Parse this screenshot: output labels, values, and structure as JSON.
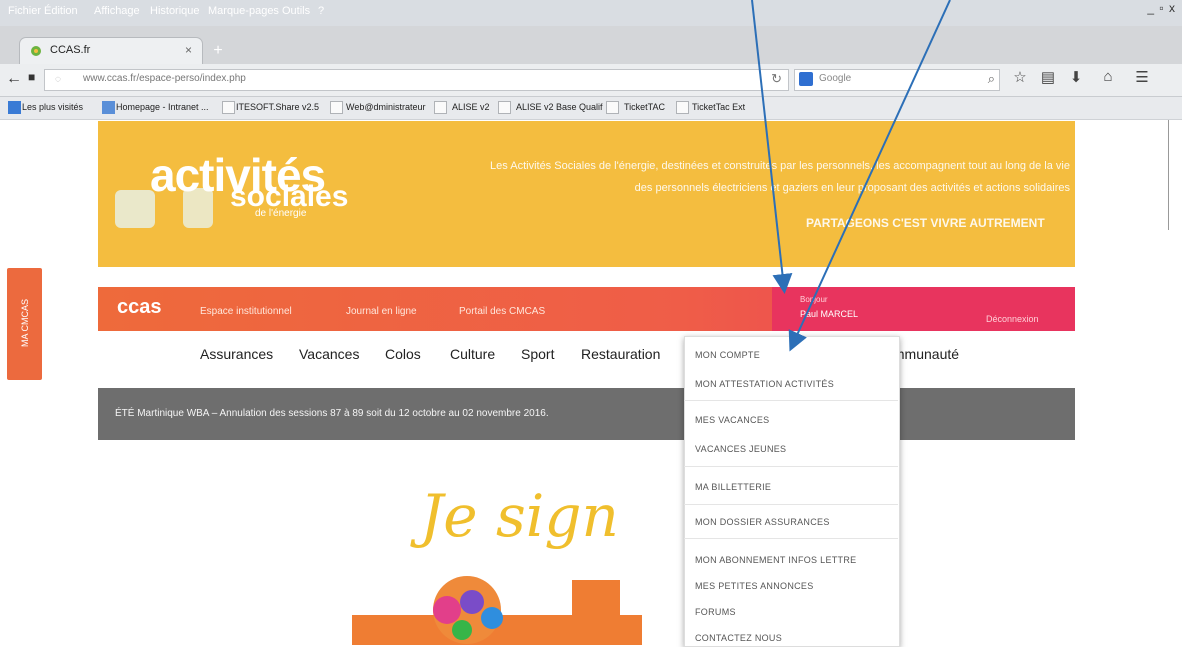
{
  "menubar": {
    "items": [
      "Fichier",
      "Édition",
      "Affichage",
      "Historique",
      "Marque-pages",
      "Outils",
      "?"
    ],
    "controls": "_ ▫ x"
  },
  "tab": {
    "title": "CCAS.fr",
    "close": "×",
    "new": "+"
  },
  "navbar": {
    "url": "www.ccas.fr/espace-perso/index.php",
    "search_placeholder": "Google"
  },
  "bookmarks": [
    "Les plus visités",
    "Homepage - Intranet ...",
    "ITESOFT.Share v2.5",
    "Web@dministrateur",
    "ALISE v2",
    "ALISE v2 Base Qualif",
    "TicketTAC",
    "TicketTac Ext"
  ],
  "header": {
    "logo_line1": "activités",
    "logo_line2": "sociales",
    "logo_sub": "de l'énergie",
    "text_line1": "Les Activités Sociales de l'énergie, destinées et construites par les personnels, les accompagnent tout au long de la vie",
    "text_line2": "des personnels électriciens et gaziers en leur proposant des activités et actions solidaires",
    "slogan": "PARTAGEONS C'EST VIVRE AUTREMENT"
  },
  "side_tab": "MA CMCAS",
  "orange_nav": {
    "logo": "ccas",
    "links": [
      "Espace institutionnel",
      "Journal en ligne",
      "Portail des CMCAS"
    ],
    "greeting": "Bonjour",
    "user": "Paul MARCEL",
    "logout": "Déconnexion"
  },
  "main_nav": [
    "Assurances",
    "Vacances",
    "Colos",
    "Culture",
    "Sport",
    "Restauration",
    "Communauté"
  ],
  "alert": "ÉTÉ Martinique WBA – Annulation des sessions 87 à 89 soit du 12 octobre au 02 novembre 2016.",
  "hero": {
    "title": "Je sign"
  },
  "dropdown": [
    "MON COMPTE",
    "MON ATTESTATION ACTIVITÉS",
    "MES VACANCES",
    "VACANCES JEUNES",
    "MA BILLETTERIE",
    "MON DOSSIER ASSURANCES",
    "MON ABONNEMENT INFOS LETTRE",
    "MES PETITES ANNONCES",
    "FORUMS",
    "CONTACTEZ NOUS"
  ],
  "colors": {
    "banner": "#f4bd3f",
    "nav_orange": "#ee6a3b",
    "nav_pink": "#e8345e",
    "alert": "#6e6e6e",
    "arrow": "#2c6fb7"
  }
}
